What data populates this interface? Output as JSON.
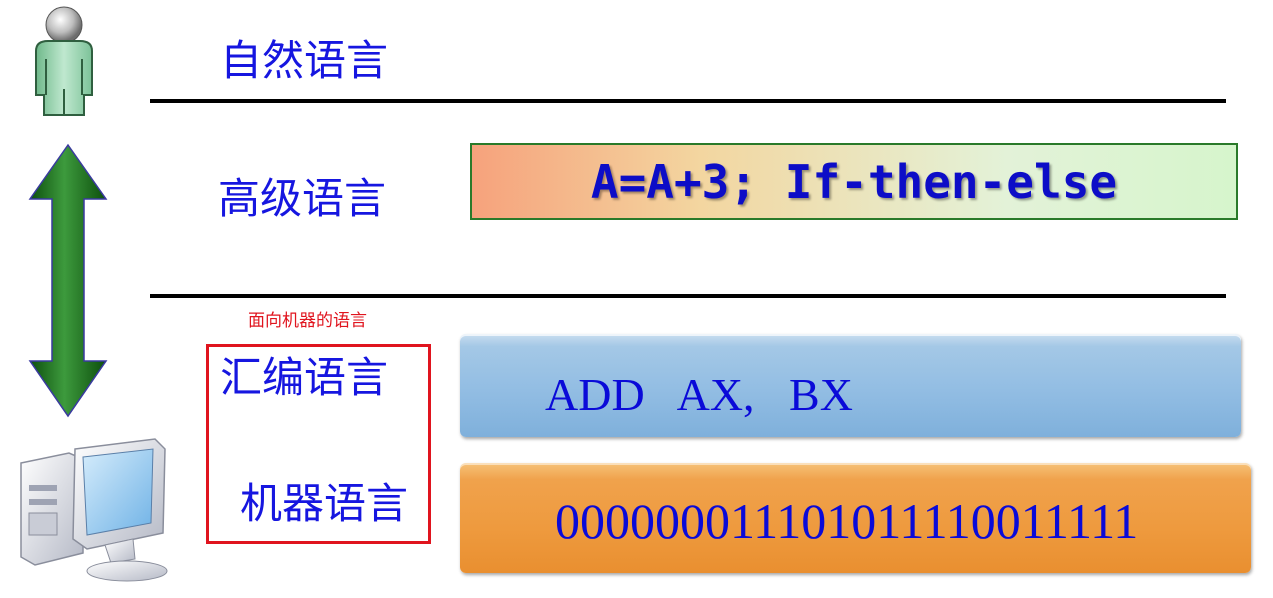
{
  "levels": {
    "natural": {
      "label": "自然语言"
    },
    "high": {
      "label": "高级语言",
      "code": "A=A+3; If-then-else"
    },
    "machine_oriented_note": "面向机器的语言",
    "assembly": {
      "label": "汇编语言",
      "code": "ADD   AX,   BX"
    },
    "machine": {
      "label": "机器语言",
      "code": "000000011101011110011111"
    }
  },
  "icons": {
    "person": "person-icon",
    "arrow": "double-arrow-icon",
    "computer": "computer-icon"
  },
  "colors": {
    "label_blue": "#1616e0",
    "arrow_green": "#1f7a1f",
    "note_red": "#e0141e"
  }
}
